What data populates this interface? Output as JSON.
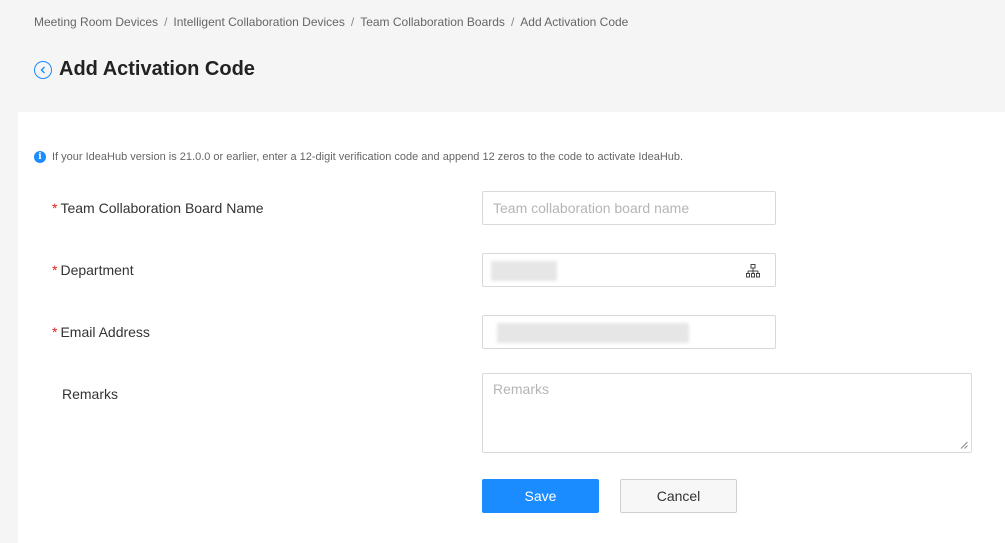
{
  "breadcrumb": {
    "items": [
      "Meeting Room Devices",
      "Intelligent Collaboration Devices",
      "Team Collaboration Boards",
      "Add Activation Code"
    ],
    "separator": "/"
  },
  "header": {
    "title": "Add Activation Code",
    "back_icon": "chevron-left-circle-icon"
  },
  "notice": {
    "icon": "info-icon",
    "icon_glyph": "i",
    "text": "If your IdeaHub version is 21.0.0 or earlier, enter a 12-digit verification code and append 12 zeros to the code to activate IdeaHub."
  },
  "form": {
    "required_mark": "*",
    "board_name": {
      "label": "Team Collaboration Board Name",
      "placeholder": "Team collaboration board name",
      "value": ""
    },
    "department": {
      "label": "Department",
      "value_state": "redacted",
      "icon": "org-chart-icon"
    },
    "email": {
      "label": "Email Address",
      "value_state": "redacted"
    },
    "remarks": {
      "label": "Remarks",
      "placeholder": "Remarks",
      "value": ""
    }
  },
  "actions": {
    "save_label": "Save",
    "cancel_label": "Cancel"
  },
  "colors": {
    "accent": "#1a8cff",
    "required": "#e02020",
    "page_background": "#f5f5f5",
    "card_background": "#ffffff"
  }
}
